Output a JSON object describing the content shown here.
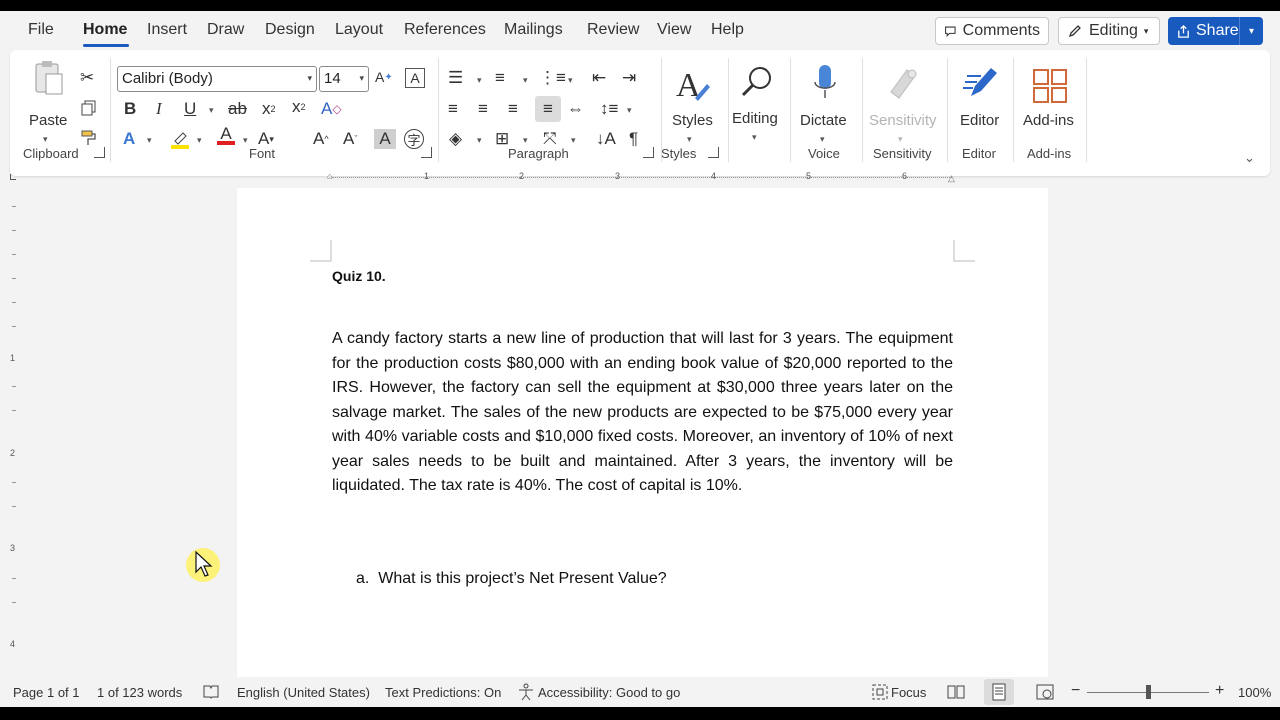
{
  "menu": {
    "tabs": [
      "File",
      "Home",
      "Insert",
      "Draw",
      "Design",
      "Layout",
      "References",
      "Mailings",
      "Review",
      "View",
      "Help"
    ],
    "active_tab": "Home",
    "comments_label": "Comments",
    "editing_label": "Editing",
    "share_label": "Share"
  },
  "ribbon": {
    "clipboard": {
      "paste": "Paste",
      "group": "Clipboard"
    },
    "font": {
      "name": "Calibri (Body)",
      "size": "14",
      "group": "Font"
    },
    "paragraph": {
      "group": "Paragraph"
    },
    "styles": {
      "label": "Styles",
      "group": "Styles"
    },
    "editing": {
      "label": "Editing"
    },
    "voice": {
      "label": "Dictate",
      "group": "Voice"
    },
    "sensitivity": {
      "label": "Sensitivity",
      "group": "Sensitivity"
    },
    "editor": {
      "label": "Editor",
      "group": "Editor"
    },
    "addins": {
      "label": "Add-ins",
      "group": "Add-ins"
    }
  },
  "ruler": {
    "h_numbers": [
      "1",
      "2",
      "3",
      "4",
      "5",
      "6"
    ],
    "v_numbers": [
      "1",
      "2",
      "3",
      "4"
    ]
  },
  "document": {
    "title": "Quiz 10.",
    "paragraph": "A candy factory starts a new line of production that will last for 3 years. The equipment for the production costs $80,000 with an ending book value of $20,000 reported to the IRS. However, the factory can sell the equipment at $30,000 three years later on the salvage market. The sales of the new products are expected to be $75,000 every year with 40% variable costs and $10,000 fixed costs. Moreover, an inventory of 10% of next year sales needs to be built and maintained. After 3 years, the inventory will be liquidated. The tax rate is 40%. The cost of capital is 10%.",
    "question_marker": "a.",
    "question": "What is this project’s Net Present Value?"
  },
  "status": {
    "page": "Page 1 of 1",
    "words": "1 of 123 words",
    "language": "English (United States)",
    "predictions": "Text Predictions: On",
    "accessibility": "Accessibility: Good to go",
    "focus": "Focus",
    "zoom": "100%",
    "zoom_minus": "−",
    "zoom_plus": "+"
  }
}
